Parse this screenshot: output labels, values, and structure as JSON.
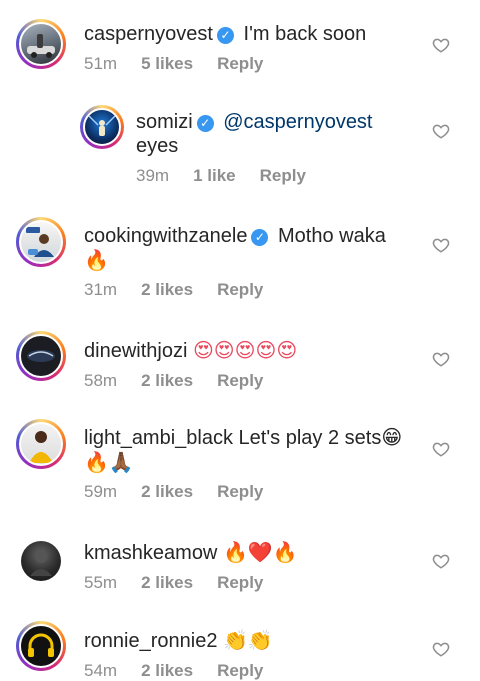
{
  "comments": [
    {
      "user": "caspernyovest",
      "verified": true,
      "text": "I'm back soon",
      "time": "51m",
      "likes": "5 likes",
      "reply": "Reply"
    },
    {
      "user": "somizi",
      "verified": true,
      "mention": "@caspernyovest",
      "text": "eyes",
      "time": "39m",
      "likes": "1 like",
      "reply": "Reply"
    },
    {
      "user": "cookingwithzanele",
      "verified": true,
      "text": "Motho waka",
      "text2": "🔥",
      "time": "31m",
      "likes": "2 likes",
      "reply": "Reply"
    },
    {
      "user": "dinewithjozi",
      "verified": false,
      "text": "😍😍😍😍😍",
      "time": "58m",
      "likes": "2 likes",
      "reply": "Reply"
    },
    {
      "user": "light_ambi_black",
      "verified": false,
      "text": "Let's play 2 sets😁",
      "text2": "🔥🙏🏾",
      "time": "59m",
      "likes": "2 likes",
      "reply": "Reply"
    },
    {
      "user": "kmashkeamow",
      "verified": false,
      "text": "🔥❤️🔥",
      "time": "55m",
      "likes": "2 likes",
      "reply": "Reply"
    },
    {
      "user": "ronnie_ronnie2",
      "verified": false,
      "text": "👏👏",
      "time": "54m",
      "likes": "2 likes",
      "reply": "Reply"
    }
  ],
  "colors": {
    "verified": "#3897f0",
    "muted": "#8e8e8e",
    "mention": "#00376b"
  }
}
